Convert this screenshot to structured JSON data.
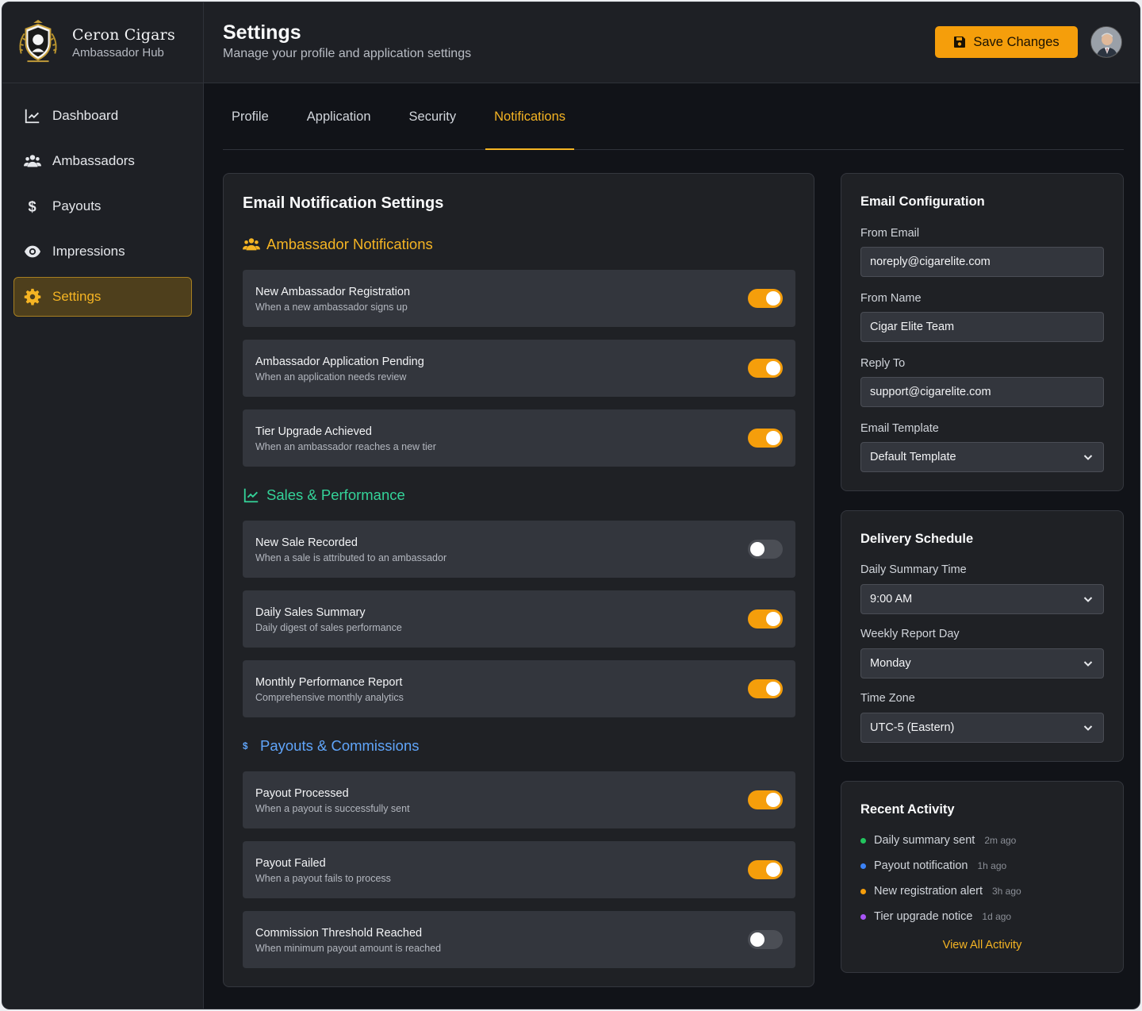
{
  "brand": {
    "name": "Ceron Cigars",
    "subtitle": "Ambassador Hub"
  },
  "nav": [
    {
      "label": "Dashboard",
      "icon": "chart-line-icon"
    },
    {
      "label": "Ambassadors",
      "icon": "users-icon"
    },
    {
      "label": "Payouts",
      "icon": "dollar-icon"
    },
    {
      "label": "Impressions",
      "icon": "eye-icon"
    },
    {
      "label": "Settings",
      "icon": "gear-icon",
      "active": true
    }
  ],
  "header": {
    "title": "Settings",
    "subtitle": "Manage your profile and application settings",
    "save_label": "Save Changes"
  },
  "tabs": [
    "Profile",
    "Application",
    "Security",
    "Notifications"
  ],
  "active_tab": "Notifications",
  "email_notifications": {
    "title": "Email Notification Settings",
    "sections": [
      {
        "title": "Ambassador Notifications",
        "color": "#f5b423",
        "icon": "users-icon",
        "items": [
          {
            "title": "New Ambassador Registration",
            "desc": "When a new ambassador signs up",
            "on": true
          },
          {
            "title": "Ambassador Application Pending",
            "desc": "When an application needs review",
            "on": true
          },
          {
            "title": "Tier Upgrade Achieved",
            "desc": "When an ambassador reaches a new tier",
            "on": true
          }
        ]
      },
      {
        "title": "Sales & Performance",
        "color": "#34d399",
        "icon": "chart-line-icon",
        "items": [
          {
            "title": "New Sale Recorded",
            "desc": "When a sale is attributed to an ambassador",
            "on": false
          },
          {
            "title": "Daily Sales Summary",
            "desc": "Daily digest of sales performance",
            "on": true
          },
          {
            "title": "Monthly Performance Report",
            "desc": "Comprehensive monthly analytics",
            "on": true
          }
        ]
      },
      {
        "title": "Payouts & Commissions",
        "color": "#60a5fa",
        "icon": "dollar-icon",
        "items": [
          {
            "title": "Payout Processed",
            "desc": "When a payout is successfully sent",
            "on": true
          },
          {
            "title": "Payout Failed",
            "desc": "When a payout fails to process",
            "on": true
          },
          {
            "title": "Commission Threshold Reached",
            "desc": "When minimum payout amount is reached",
            "on": false
          }
        ]
      }
    ]
  },
  "email_config": {
    "title": "Email Configuration",
    "from_email_label": "From Email",
    "from_email": "noreply@cigarelite.com",
    "from_name_label": "From Name",
    "from_name": "Cigar Elite Team",
    "reply_to_label": "Reply To",
    "reply_to": "support@cigarelite.com",
    "template_label": "Email Template",
    "template": "Default Template"
  },
  "delivery": {
    "title": "Delivery Schedule",
    "daily_label": "Daily Summary Time",
    "daily": "9:00 AM",
    "weekly_label": "Weekly Report Day",
    "weekly": "Monday",
    "tz_label": "Time Zone",
    "tz": "UTC-5 (Eastern)"
  },
  "activity": {
    "title": "Recent Activity",
    "items": [
      {
        "text": "Daily summary sent",
        "time": "2m ago",
        "color": "#22c55e"
      },
      {
        "text": "Payout notification",
        "time": "1h ago",
        "color": "#3b82f6"
      },
      {
        "text": "New registration alert",
        "time": "3h ago",
        "color": "#f59e0b"
      },
      {
        "text": "Tier upgrade notice",
        "time": "1d ago",
        "color": "#a855f7"
      }
    ],
    "view_all": "View All Activity"
  }
}
